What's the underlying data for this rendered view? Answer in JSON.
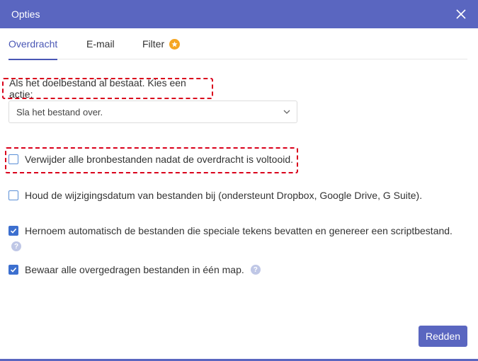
{
  "dialog": {
    "title": "Opties"
  },
  "tabs": [
    {
      "label": "Overdracht",
      "active": true
    },
    {
      "label": "E-mail",
      "active": false
    },
    {
      "label": "Filter",
      "active": false
    }
  ],
  "conflict": {
    "label": "Als het doelbestand al bestaat. Kies een actie:",
    "selected": "Sla het bestand over."
  },
  "options": [
    {
      "label": "Verwijder alle bronbestanden nadat de overdracht is voltooid.",
      "checked": false
    },
    {
      "label": "Houd de wijzigingsdatum van bestanden bij (ondersteunt Dropbox, Google Drive, G Suite).",
      "checked": false
    },
    {
      "label": "Hernoem automatisch de bestanden die speciale tekens bevatten en genereer een scriptbestand.",
      "checked": true
    },
    {
      "label": "Bewaar alle overgedragen bestanden in één map.",
      "checked": true
    }
  ],
  "help_symbol": "?",
  "save_label": "Redden",
  "colors": {
    "header": "#5a66c0",
    "accent": "#4a57b5",
    "highlight": "#d9001b",
    "checkbox": "#3c6fcf",
    "star": "#f5a623"
  }
}
